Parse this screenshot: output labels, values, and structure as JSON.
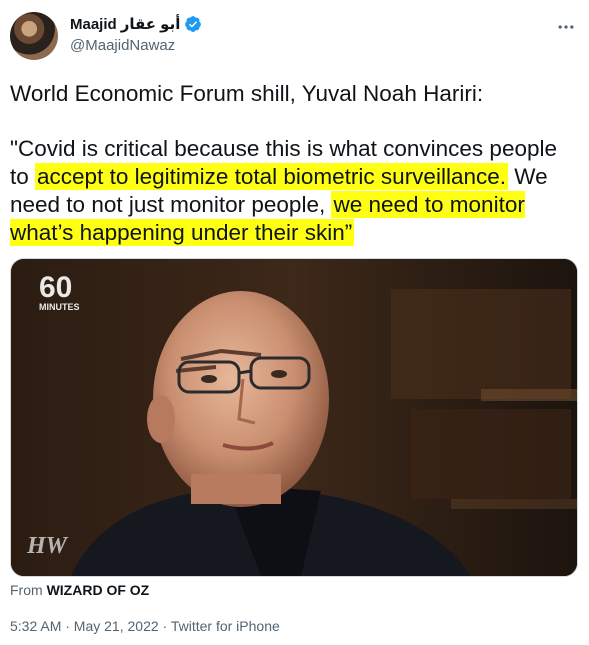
{
  "author": {
    "name": "Maajid",
    "name_arabic": "أبو عقار",
    "handle": "@MaajidNawaz"
  },
  "tweet": {
    "line1": "World Economic Forum shill, Yuval Noah Hariri:",
    "quote_part1": "\"Covid is critical because this is what convinces people to ",
    "quote_hl1": "accept to legitimize total biometric surveillance.",
    "quote_part2": " We need to not just monitor people, ",
    "quote_hl2": "we need to monitor what’s happening under their skin”"
  },
  "media": {
    "logo_number": "60",
    "logo_word": "MINUTES",
    "corner_mark": "HW"
  },
  "attribution": {
    "prefix": "From",
    "source": "WIZARD OF OZ"
  },
  "meta": {
    "timestamp": "5:32 AM · May 21, 2022 · Twitter for iPhone"
  },
  "colors": {
    "highlight": "#ffff12",
    "verified": "#1d9bf0",
    "secondary_text": "#536471"
  },
  "icons": {
    "verified": "verified-badge-icon",
    "more": "more-options-icon"
  }
}
